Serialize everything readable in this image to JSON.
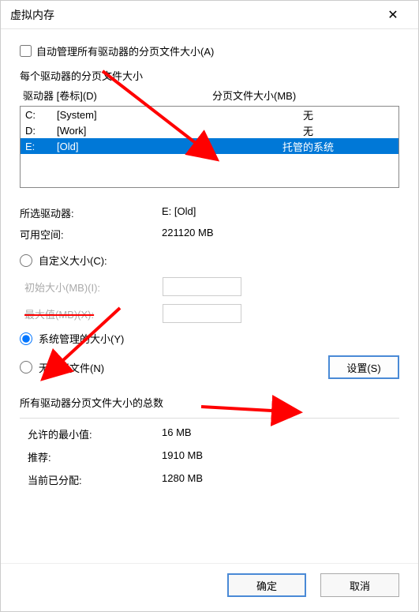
{
  "title": "虚拟内存",
  "auto_manage_label": "自动管理所有驱动器的分页文件大小(A)",
  "auto_manage_checked": false,
  "per_drive_label": "每个驱动器的分页文件大小",
  "drive_header_left": "驱动器 [卷标](D)",
  "drive_header_right": "分页文件大小(MB)",
  "drives": [
    {
      "letter": "C:",
      "label": "[System]",
      "size": "无",
      "selected": false
    },
    {
      "letter": "D:",
      "label": "[Work]",
      "size": "无",
      "selected": false
    },
    {
      "letter": "E:",
      "label": "[Old]",
      "size": "托管的系统",
      "selected": true
    }
  ],
  "selected_drive_label": "所选驱动器:",
  "selected_drive_value": "E:  [Old]",
  "free_space_label": "可用空间:",
  "free_space_value": "221120 MB",
  "radio_custom": "自定义大小(C):",
  "initial_size_label": "初始大小(MB)(I):",
  "max_size_label": "最大值(MB)(X):",
  "radio_system": "系统管理的大小(Y)",
  "radio_none": "无分页文件(N)",
  "set_button": "设置(S)",
  "totals_label": "所有驱动器分页文件大小的总数",
  "min_allowed_label": "允许的最小值:",
  "min_allowed_value": "16 MB",
  "recommended_label": "推荐:",
  "recommended_value": "1910 MB",
  "current_label": "当前已分配:",
  "current_value": "1280 MB",
  "ok_button": "确定",
  "cancel_button": "取消"
}
